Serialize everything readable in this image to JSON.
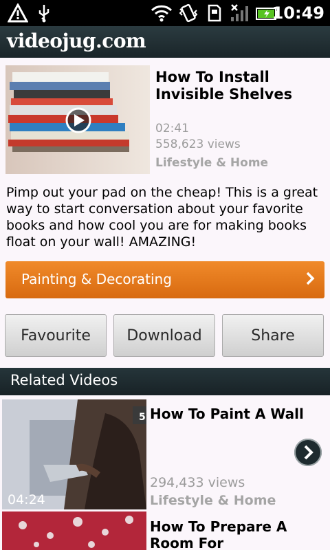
{
  "status_bar": {
    "time": "10:49"
  },
  "app": {
    "brand": "videojug.com"
  },
  "featured": {
    "title": "How To Install Invisible Shelves",
    "duration": "02:41",
    "views": "558,623 views",
    "category": "Lifestyle & Home",
    "description": "Pimp out your pad on the cheap! This is a great way to start conversation about your favorite books and how cool you are for making books float on your wall! AMAZING!"
  },
  "category_button": {
    "label": "Painting & Decorating"
  },
  "actions": {
    "favourite": "Favourite",
    "download": "Download",
    "share": "Share"
  },
  "related": {
    "heading": "Related Videos",
    "items": [
      {
        "title": "How To Paint A Wall",
        "views": "294,433 views",
        "category": "Lifestyle & Home",
        "duration": "04:24"
      },
      {
        "title": "How To Prepare A Room For"
      }
    ]
  },
  "colors": {
    "accent": "#e57b1f",
    "header": "#1f2d31"
  },
  "icons": [
    "warning-icon",
    "usb-icon",
    "wifi-icon",
    "vibrate-icon",
    "sdcard-icon",
    "signal-icon",
    "battery-icon",
    "play-icon",
    "chevron-right-icon"
  ]
}
